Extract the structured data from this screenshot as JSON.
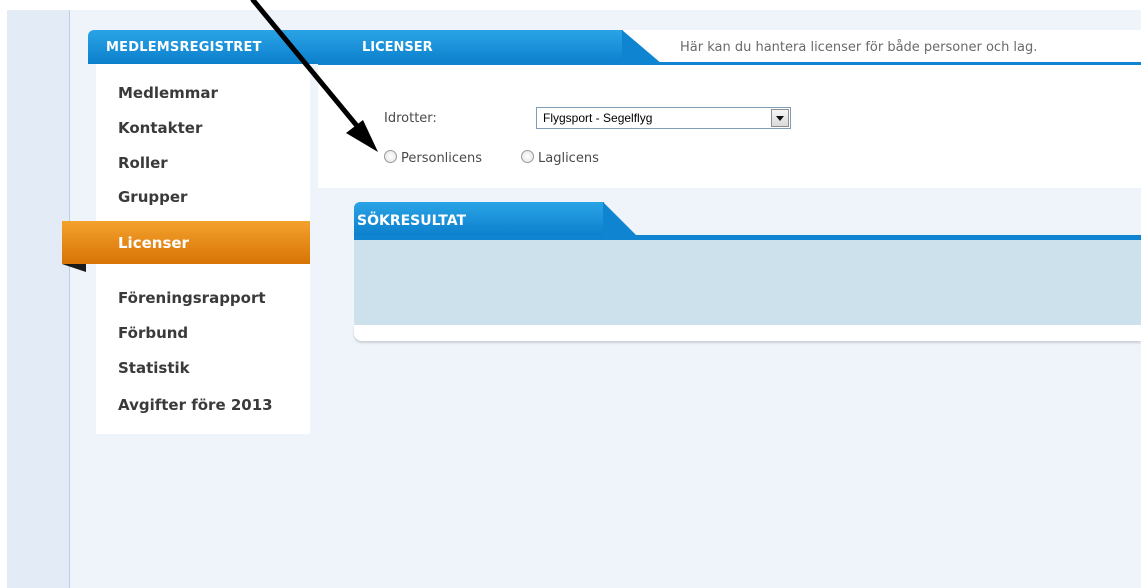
{
  "sidebar": {
    "title": "MEDLEMSREGISTRET",
    "items": [
      {
        "label": "Medlemmar"
      },
      {
        "label": "Kontakter"
      },
      {
        "label": "Roller"
      },
      {
        "label": "Grupper"
      },
      {
        "label": "Licenser",
        "active": true
      },
      {
        "label": "Föreningsrapport"
      },
      {
        "label": "Förbund"
      },
      {
        "label": "Statistik"
      },
      {
        "label": "Avgifter före 2013"
      }
    ]
  },
  "main": {
    "tab_title": "LICENSER",
    "description": "Här kan du hantera licenser för både personer och lag.",
    "form": {
      "idrotter_label": "Idrotter:",
      "idrotter_value": "Flygsport - Segelflyg",
      "radio_options": [
        "Personlicens",
        "Laglicens"
      ]
    },
    "results": {
      "title": "SÖKRESULTAT"
    }
  },
  "colors": {
    "header_blue": "#0f84d0",
    "active_orange": "#e58510",
    "results_body": "#cde1ec",
    "page_background": "#eef4fa"
  },
  "annotation": {
    "arrow_icon": "arrow-pointing-to-personlicens-radio"
  }
}
